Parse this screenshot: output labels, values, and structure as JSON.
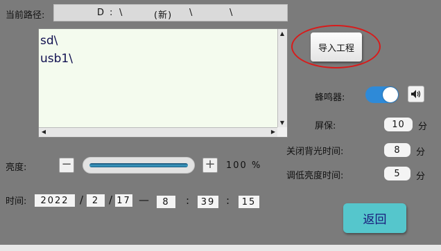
{
  "path": {
    "label": "当前路径:",
    "drive": "D",
    "colon": ":",
    "sep1": "\\",
    "folder": "(新)",
    "sep2": "\\",
    "sep3": "\\"
  },
  "file_list": {
    "items": [
      "sd\\",
      "usb1\\"
    ]
  },
  "import_button": {
    "label": "导入工程"
  },
  "buzzer": {
    "label": "蜂鸣器:",
    "enabled": true
  },
  "settings": {
    "screensaver": {
      "label": "屏保:",
      "value": "10",
      "unit": "分"
    },
    "backlight_off": {
      "label": "关闭背光时间:",
      "value": "8",
      "unit": "分"
    },
    "dim_time": {
      "label": "调低亮度时间:",
      "value": "5",
      "unit": "分"
    }
  },
  "brightness": {
    "label": "亮度:",
    "minus": "−",
    "plus": "+",
    "value_text": "100 %",
    "level": 1.0
  },
  "time": {
    "label": "时间:",
    "year": "2022",
    "month": "2",
    "day": "17",
    "hour": "8",
    "minute": "39",
    "second": "15",
    "date_sep": "/",
    "dash": "—",
    "time_sep": ":"
  },
  "back_button": {
    "label": "返回"
  },
  "colors": {
    "background": "#7b7b7b",
    "toggle_on": "#2e8ad8",
    "back_button": "#55c6cc",
    "highlight": "#d81b1b"
  }
}
